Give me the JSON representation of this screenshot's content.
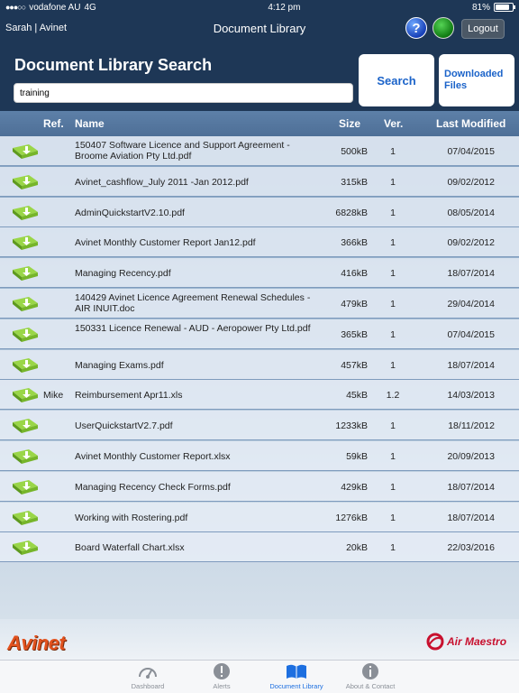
{
  "status_bar": {
    "carrier": "vodafone AU",
    "network": "4G",
    "time": "4:12 pm",
    "battery": "81%",
    "battery_level": 0.81
  },
  "nav": {
    "user": "Sarah | Avinet",
    "title": "Document Library",
    "help_label": "?",
    "logout_label": "Logout"
  },
  "search": {
    "title": "Document Library Search",
    "value": "training",
    "search_label": "Search",
    "downloaded_label": "Downloaded Files"
  },
  "table": {
    "headers": {
      "ref": "Ref.",
      "name": "Name",
      "size": "Size",
      "ver": "Ver.",
      "modified": "Last Modified"
    },
    "rows": [
      {
        "ref": "",
        "name": "150407 Software Licence and Support Agreement - Broome Aviation Pty Ltd.pdf",
        "size": "500kB",
        "ver": "1",
        "modified": "07/04/2015"
      },
      {
        "ref": "",
        "name": "Avinet_cashflow_July 2011 -Jan 2012.pdf",
        "size": "315kB",
        "ver": "1",
        "modified": "09/02/2012"
      },
      {
        "ref": "",
        "name": "AdminQuickstartV2.10.pdf",
        "size": "6828kB",
        "ver": "1",
        "modified": "08/05/2014"
      },
      {
        "ref": "",
        "name": "Avinet Monthly Customer Report Jan12.pdf",
        "size": "366kB",
        "ver": "1",
        "modified": "09/02/2012"
      },
      {
        "ref": "",
        "name": "Managing Recency.pdf",
        "size": "416kB",
        "ver": "1",
        "modified": "18/07/2014"
      },
      {
        "ref": "",
        "name": "140429 Avinet Licence Agreement Renewal Schedules - AIR INUIT.doc",
        "size": "479kB",
        "ver": "1",
        "modified": "29/04/2014"
      },
      {
        "ref": "",
        "name": "150331 Licence Renewal - AUD - Aeropower Pty Ltd.pdf",
        "size": "365kB",
        "ver": "1",
        "modified": "07/04/2015"
      },
      {
        "ref": "",
        "name": "Managing Exams.pdf",
        "size": "457kB",
        "ver": "1",
        "modified": "18/07/2014"
      },
      {
        "ref": "Mike",
        "name": "Reimbursement Apr11.xls",
        "size": "45kB",
        "ver": "1.2",
        "modified": "14/03/2013"
      },
      {
        "ref": "",
        "name": "UserQuickstartV2.7.pdf",
        "size": "1233kB",
        "ver": "1",
        "modified": "18/11/2012"
      },
      {
        "ref": "",
        "name": "Avinet Monthly Customer Report.xlsx",
        "size": "59kB",
        "ver": "1",
        "modified": "20/09/2013"
      },
      {
        "ref": "",
        "name": "Managing Recency Check Forms.pdf",
        "size": "429kB",
        "ver": "1",
        "modified": "18/07/2014"
      },
      {
        "ref": "",
        "name": "Working with Rostering.pdf",
        "size": "1276kB",
        "ver": "1",
        "modified": "18/07/2014"
      },
      {
        "ref": "",
        "name": "Board Waterfall Chart.xlsx",
        "size": "20kB",
        "ver": "1",
        "modified": "22/03/2016"
      }
    ]
  },
  "logos": {
    "avinet": "Avinet",
    "airmaestro": "Air Maestro"
  },
  "tabs": [
    {
      "label": "Dashboard",
      "icon": "dashboard-icon",
      "active": false
    },
    {
      "label": "Alerts",
      "icon": "alert-icon",
      "active": false
    },
    {
      "label": "Document Library",
      "icon": "book-icon",
      "active": true
    },
    {
      "label": "About & Contact",
      "icon": "info-icon",
      "active": false
    }
  ],
  "colors": {
    "header_bg": "#1e3756",
    "accent_blue": "#1b63c9",
    "download_green": "#7cc12e",
    "active_tab": "#1d6fe0"
  }
}
